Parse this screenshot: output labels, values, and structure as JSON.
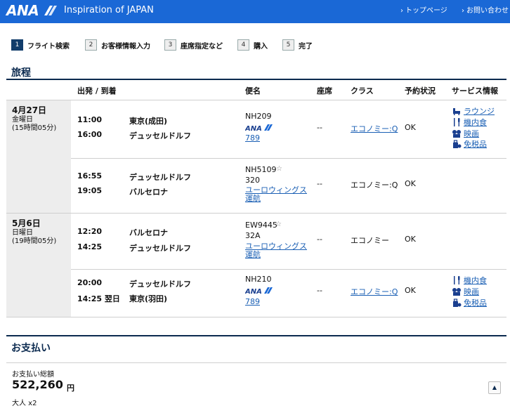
{
  "header": {
    "logo": "ANA",
    "tagline": "Inspiration of JAPAN",
    "links": [
      "トップページ",
      "お問い合わせ"
    ]
  },
  "steps": [
    {
      "num": "1",
      "label": "フライト検索"
    },
    {
      "num": "2",
      "label": "お客様情報入力"
    },
    {
      "num": "3",
      "label": "座席指定など"
    },
    {
      "num": "4",
      "label": "購入"
    },
    {
      "num": "5",
      "label": "完了"
    }
  ],
  "itinerary": {
    "title": "旅程",
    "headers": {
      "route": "出発 / 到着",
      "flight": "便名",
      "seat": "座席",
      "class": "クラス",
      "status": "予約状況",
      "service": "サービス情報"
    },
    "days": [
      {
        "date": "4月27日",
        "weekday": "金曜日",
        "duration": "(15時間05分)"
      },
      {
        "date": "5月6日",
        "weekday": "日曜日",
        "duration": "(19時間05分)"
      }
    ],
    "flights": [
      {
        "dep_time": "11:00",
        "dep_city": "東京(成田)",
        "arr_time": "16:00",
        "arr_city": "デュッセルドルフ",
        "flight_no": "NH209",
        "carrier_logo": "ANA",
        "aircraft": "789",
        "seat": "--",
        "class": "エコノミー:Q",
        "status": "OK",
        "services": [
          "ラウンジ",
          "機内食",
          "映画",
          "免税品"
        ]
      },
      {
        "dep_time": "16:55",
        "dep_city": "デュッセルドルフ",
        "arr_time": "19:05",
        "arr_city": "バルセロナ",
        "flight_no": "NH5109",
        "aircraft": "320",
        "operator": "ユーロウィングス運航",
        "seat": "--",
        "class": "エコノミー:Q",
        "status": "OK",
        "services": []
      },
      {
        "dep_time": "12:20",
        "dep_city": "バルセロナ",
        "arr_time": "14:25",
        "arr_city": "デュッセルドルフ",
        "flight_no": "EW9445",
        "aircraft": "32A",
        "operator": "ユーロウィングス運航",
        "seat": "--",
        "class": "エコノミー",
        "status": "OK",
        "services": []
      },
      {
        "dep_time": "20:00",
        "dep_city": "デュッセルドルフ",
        "arr_time": "14:25 翌日",
        "arr_city": "東京(羽田)",
        "flight_no": "NH210",
        "carrier_logo": "ANA",
        "aircraft": "789",
        "seat": "--",
        "class": "エコノミー:Q",
        "status": "OK",
        "services": [
          "機内食",
          "映画",
          "免税品"
        ]
      }
    ]
  },
  "payment": {
    "title": "お支払い",
    "total_label": "お支払い総額",
    "amount": "522,260",
    "currency": "円",
    "passengers": "大人 x2",
    "scroll_top_icon": "▲"
  },
  "colors": {
    "header_bg": "#1a68d6",
    "rule": "#0b2a4f",
    "link": "#1a5fb4",
    "day_bg": "#ededed"
  }
}
